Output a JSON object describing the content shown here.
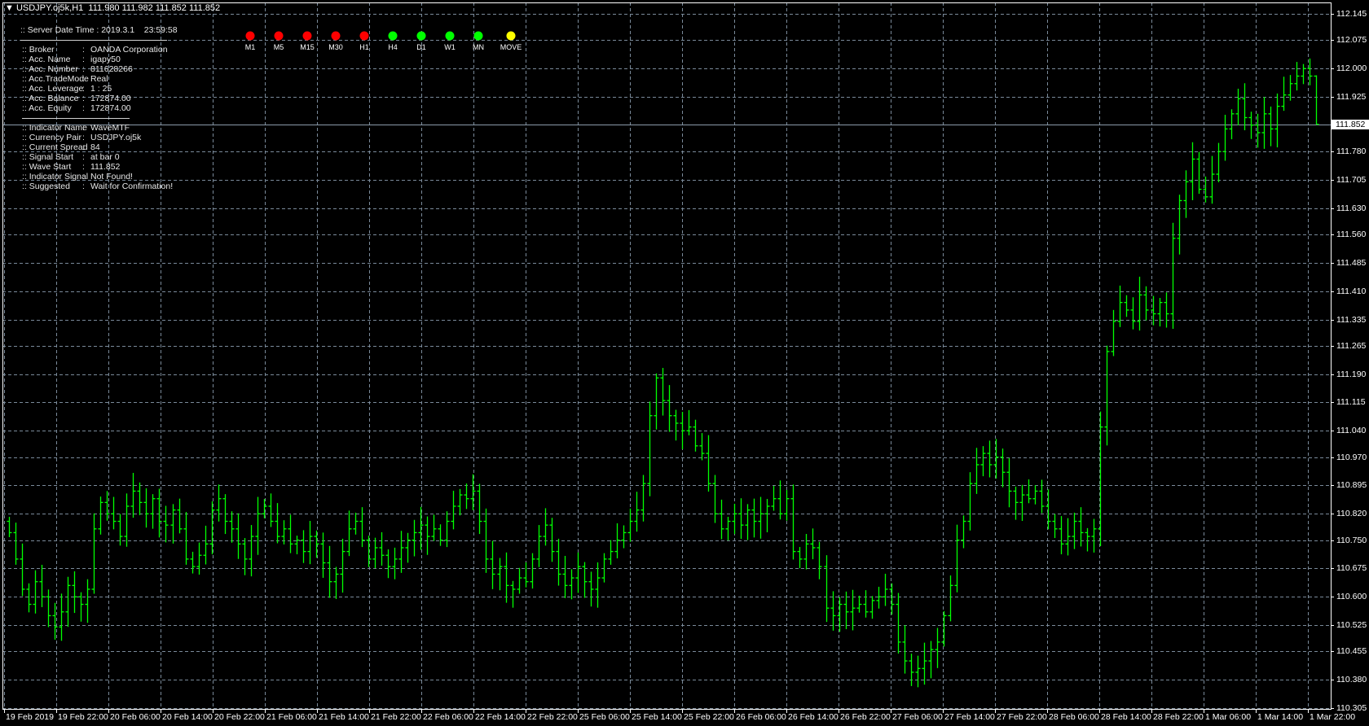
{
  "window": {
    "title": "USDJPY.oj5k,H1",
    "ohlc": "111.980 111.982 111.852 111.852"
  },
  "info": {
    "server_time": ":: Server Date Time : 2019.3.1    23:59:58",
    "account": [
      {
        "label": ":: Broker",
        "value": "OANDA Corporation"
      },
      {
        "label": ":: Acc. Name",
        "value": "igapy50"
      },
      {
        "label": ":: Acc. Number",
        "value": "811628266"
      },
      {
        "label": ":: Acc.TradeMode",
        "value": "Real"
      },
      {
        "label": ":: Acc. Leverage",
        "value": "1 : 25"
      },
      {
        "label": ":: Acc. Balance",
        "value": "172874.00"
      },
      {
        "label": ":: Acc. Equity",
        "value": "172874.00"
      }
    ],
    "indicator": [
      {
        "label": ":: Indicator Name",
        "value": "WaveMTF"
      },
      {
        "label": ":: Currency Pair",
        "value": "USDJPY.oj5k"
      },
      {
        "label": ":: Current Spread",
        "value": "84"
      },
      {
        "label": ":: Signal Start",
        "value": "at bar 0"
      },
      {
        "label": ":: Wave Start",
        "value": "111.852"
      },
      {
        "label": ":: Indicator Signal",
        "value": "Not Found!"
      },
      {
        "label": ":: Suggested",
        "value": "Wait for Confirmation!"
      }
    ]
  },
  "signals": [
    {
      "label": "M1",
      "color": "#ff0000"
    },
    {
      "label": "M5",
      "color": "#ff0000"
    },
    {
      "label": "M15",
      "color": "#ff0000"
    },
    {
      "label": "M30",
      "color": "#ff0000"
    },
    {
      "label": "H1",
      "color": "#ff0000"
    },
    {
      "label": "H4",
      "color": "#00ff00"
    },
    {
      "label": "D1",
      "color": "#00ff00"
    },
    {
      "label": "W1",
      "color": "#00ff00"
    },
    {
      "label": "MN",
      "color": "#00ff00"
    },
    {
      "label": "MOVE",
      "color": "#ffff00"
    }
  ],
  "colors": {
    "bars": "#00ff00",
    "grid": "#7a8a9a",
    "current_price_line": "#8a9aaa"
  },
  "chart_data": {
    "type": "ohlc-bar",
    "symbol": "USDJPY.oj5k",
    "timeframe": "H1",
    "current_price": 111.852,
    "ylim": [
      110.305,
      112.145
    ],
    "price_ticks": [
      "112.145",
      "112.075",
      "112.000",
      "111.925",
      "111.780",
      "111.705",
      "111.630",
      "111.560",
      "111.485",
      "111.410",
      "111.335",
      "111.265",
      "111.190",
      "111.115",
      "111.040",
      "110.970",
      "110.895",
      "110.820",
      "110.750",
      "110.675",
      "110.600",
      "110.525",
      "110.455",
      "110.380",
      "110.305"
    ],
    "time_ticks": [
      "19 Feb 2019",
      "19 Feb 22:00",
      "20 Feb 06:00",
      "20 Feb 14:00",
      "20 Feb 22:00",
      "21 Feb 06:00",
      "21 Feb 14:00",
      "21 Feb 22:00",
      "22 Feb 06:00",
      "22 Feb 14:00",
      "22 Feb 22:00",
      "25 Feb 06:00",
      "25 Feb 14:00",
      "25 Feb 22:00",
      "26 Feb 06:00",
      "26 Feb 14:00",
      "26 Feb 22:00",
      "27 Feb 06:00",
      "27 Feb 14:00",
      "27 Feb 22:00",
      "28 Feb 06:00",
      "28 Feb 14:00",
      "28 Feb 22:00",
      "1 Mar 06:00",
      "1 Mar 14:00",
      "1 Mar 22:00"
    ],
    "grid": true,
    "close": [
      110.77,
      110.7,
      110.62,
      110.58,
      110.64,
      110.6,
      110.55,
      110.52,
      110.56,
      110.63,
      110.6,
      110.58,
      110.62,
      110.78,
      110.85,
      110.82,
      110.8,
      110.76,
      110.84,
      110.88,
      110.85,
      110.82,
      110.86,
      110.8,
      110.79,
      110.83,
      110.78,
      110.7,
      110.68,
      110.71,
      110.74,
      110.83,
      110.86,
      110.8,
      110.78,
      110.74,
      110.7,
      110.76,
      110.82,
      110.84,
      110.8,
      110.76,
      110.78,
      110.74,
      110.75,
      110.72,
      110.76,
      110.74,
      110.69,
      110.64,
      110.66,
      110.72,
      110.78,
      110.8,
      110.75,
      110.7,
      110.73,
      110.71,
      110.68,
      110.7,
      110.73,
      110.75,
      110.77,
      110.79,
      110.76,
      110.78,
      110.75,
      110.8,
      110.84,
      110.87,
      110.86,
      110.88,
      110.8,
      110.7,
      110.66,
      110.68,
      110.63,
      110.62,
      110.65,
      110.64,
      110.7,
      110.76,
      110.79,
      110.72,
      110.66,
      110.63,
      110.65,
      110.68,
      110.64,
      110.62,
      110.65,
      110.7,
      110.72,
      110.75,
      110.77,
      110.8,
      110.83,
      110.9,
      111.08,
      111.18,
      111.12,
      111.08,
      111.06,
      111.04,
      111.05,
      111.0,
      110.98,
      110.9,
      110.82,
      110.78,
      110.8,
      110.82,
      110.79,
      110.83,
      110.8,
      110.82,
      110.84,
      110.86,
      110.82,
      110.86,
      110.72,
      110.7,
      110.74,
      110.73,
      110.68,
      110.57,
      110.55,
      110.58,
      110.56,
      110.57,
      110.58,
      110.56,
      110.59,
      110.6,
      110.62,
      110.58,
      110.48,
      110.43,
      110.4,
      110.41,
      110.43,
      110.46,
      110.48,
      110.55,
      110.63,
      110.75,
      110.8,
      110.9,
      110.95,
      110.98,
      110.95,
      110.97,
      110.93,
      110.88,
      110.85,
      110.87,
      110.86,
      110.88,
      110.84,
      110.8,
      110.78,
      110.74,
      110.76,
      110.8,
      110.77,
      110.76,
      110.78,
      111.05,
      111.25,
      111.33,
      111.38,
      111.36,
      111.33,
      111.4,
      111.36,
      111.35,
      111.38,
      111.35,
      111.55,
      111.65,
      111.7,
      111.76,
      111.68,
      111.66,
      111.72,
      111.78,
      111.84,
      111.88,
      111.92,
      111.87,
      111.85,
      111.83,
      111.88,
      111.84,
      111.9,
      111.93,
      111.96,
      111.98,
      112.0,
      111.98,
      111.852
    ]
  }
}
